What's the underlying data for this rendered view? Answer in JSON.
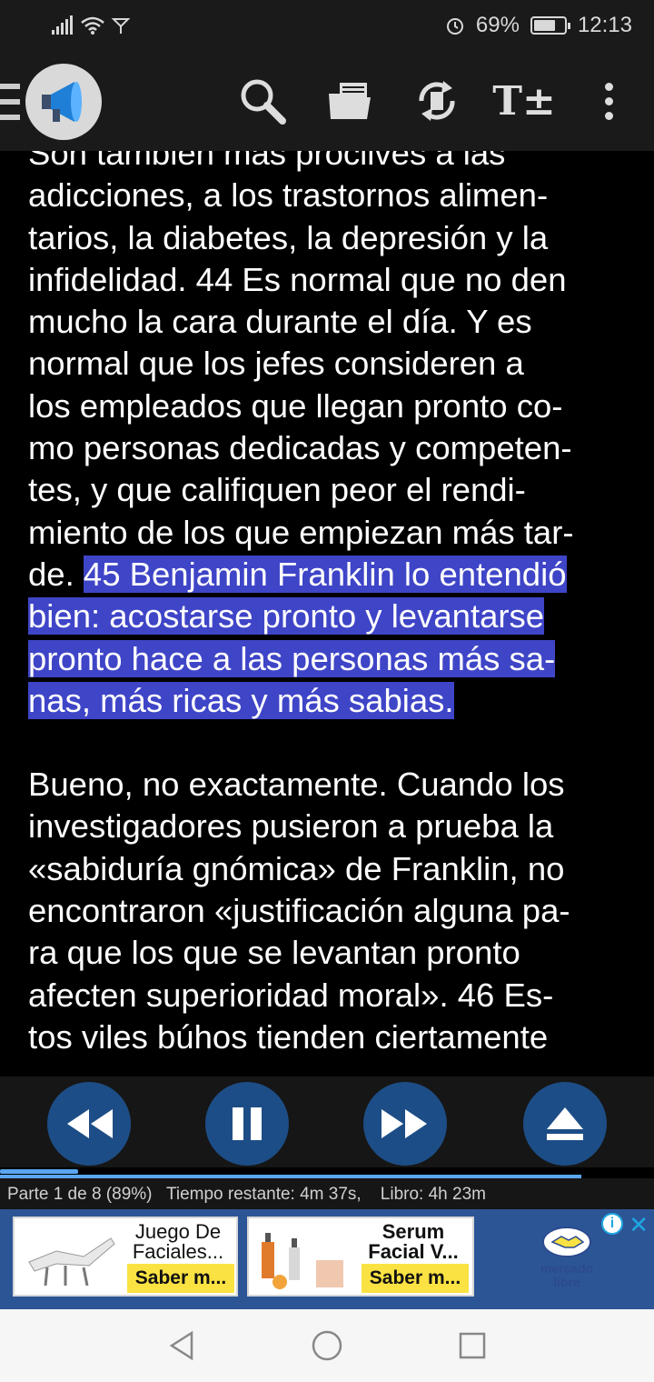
{
  "status_bar": {
    "battery_percent": "69%",
    "battery_level": 0.69,
    "time": "12:13"
  },
  "toolbar": {
    "icons": [
      "menu-icon",
      "megaphone-icon",
      "search-icon",
      "folder-icon",
      "sync-icon",
      "text-size-icon",
      "more-vert-icon"
    ],
    "text_size_label": "T±"
  },
  "reader": {
    "paragraph1_plain": "Son tambien mas proclives a las\nadicciones, a los trastornos alimen-\ntarios, la diabetes, la depresión y la\ninfidelidad. 44 Es normal que no den\nmucho la cara durante el día. Y es\nnormal que los jefes consideren a\nlos empleados que llegan pronto co-\nmo personas dedicadas y competen-\ntes, y que califiquen peor el rendi-\nmiento de los que empiezan más tar-\nde. ",
    "paragraph1_highlight": "45 Benjamin Franklin lo entendió\nbien: acostarse pronto y levantarse\npronto hace a las personas más sa-\nnas, más ricas y más sabias.",
    "paragraph2": "Bueno, no exactamente. Cuando los\ninvestigadores pusieron a prueba la\n«sabiduría gnómica» de Franklin, no\nencontraron «justificación alguna pa-\nra que los que se levantan pronto\nafecten superioridad moral». 46 Es-\ntos viles búhos tienden ciertamente",
    "highlight_color": "#3f45c7"
  },
  "player": {
    "buttons": [
      "rewind-icon",
      "pause-icon",
      "fast-forward-icon",
      "eject-icon"
    ],
    "part_progress": 0.12,
    "info_line": "Parte 1 de 8 (89%)   Tiempo restante: 4m 37s,    Libro: 4h 23m"
  },
  "ad": {
    "card1_title": "Juego De\nFaciales...",
    "card1_cta": "Saber m...",
    "card2_title": "Serum\nFacial V...",
    "card2_cta": "Saber m...",
    "brand": "mercado\nlibre",
    "info_symbol": "i",
    "close_symbol": "✕"
  },
  "nav": {
    "icons": [
      "back-icon",
      "home-icon",
      "recents-icon"
    ]
  }
}
